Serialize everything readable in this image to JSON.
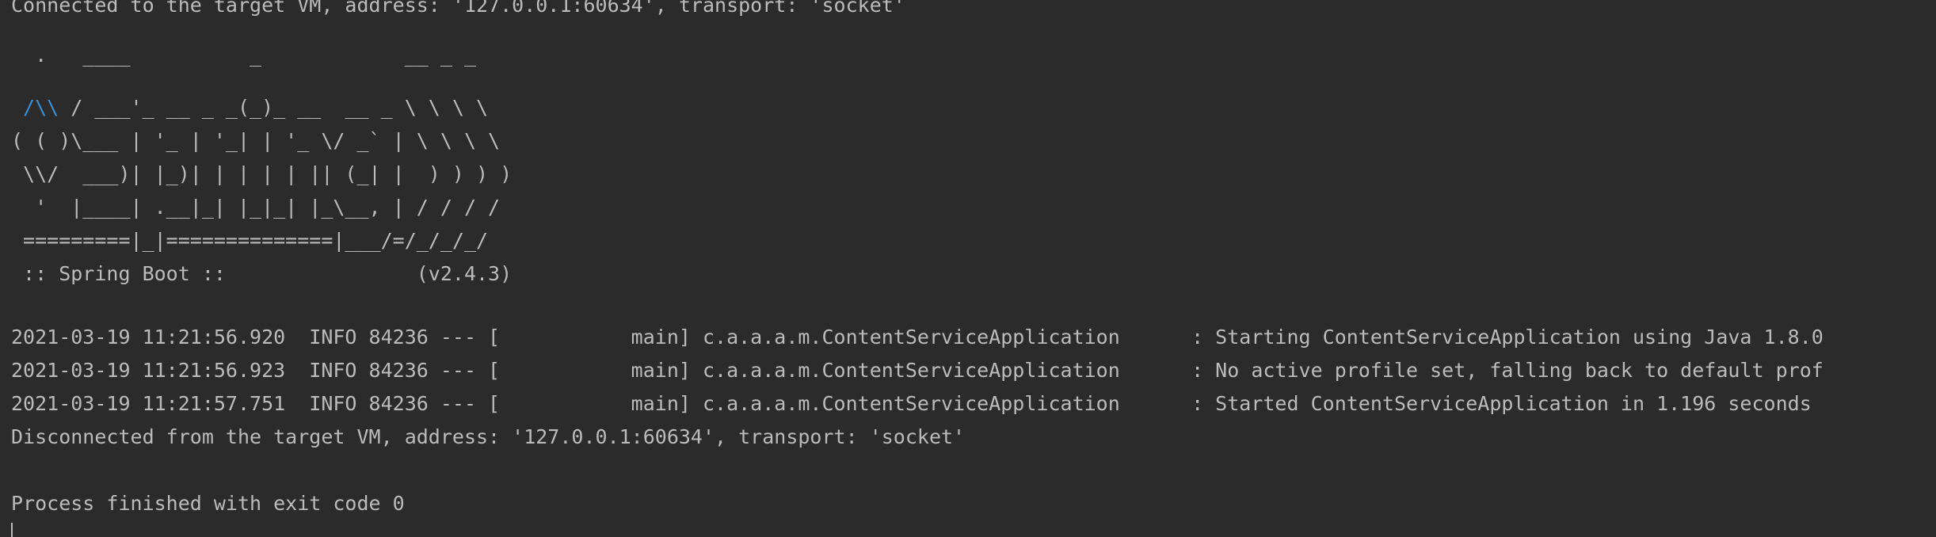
{
  "console": {
    "connected": "Connected to the target VM, address: '127.0.0.1:60634', transport: 'socket'",
    "banner": [
      "  .   ____          _            __ _ _",
      {
        "accent": " /\\\\",
        "rest": " / ___'_ __ _ _(_)_ __  __ _ \\ \\ \\ \\"
      },
      "( ( )\\___ | '_ | '_| | '_ \\/ _` | \\ \\ \\ \\",
      " \\\\/  ___)| |_)| | | | | || (_| |  ) ) ) )",
      "  '  |____| .__|_| |_|_| |_\\__, | / / / /",
      " =========|_|==============|___/=/_/_/_/",
      " :: Spring Boot ::                (v2.4.3)"
    ],
    "logs": [
      "2021-03-19 11:21:56.920  INFO 84236 --- [           main] c.a.a.a.m.ContentServiceApplication      : Starting ContentServiceApplication using Java 1.8.0",
      "2021-03-19 11:21:56.923  INFO 84236 --- [           main] c.a.a.a.m.ContentServiceApplication      : No active profile set, falling back to default prof",
      "2021-03-19 11:21:57.751  INFO 84236 --- [           main] c.a.a.a.m.ContentServiceApplication      : Started ContentServiceApplication in 1.196 seconds"
    ],
    "disconnected": "Disconnected from the target VM, address: '127.0.0.1:60634', transport: 'socket'",
    "finished": "Process finished with exit code 0"
  },
  "colors": {
    "background": "#2b2b2b",
    "text": "#bbbbbb",
    "accent": "#3d8fd4"
  }
}
